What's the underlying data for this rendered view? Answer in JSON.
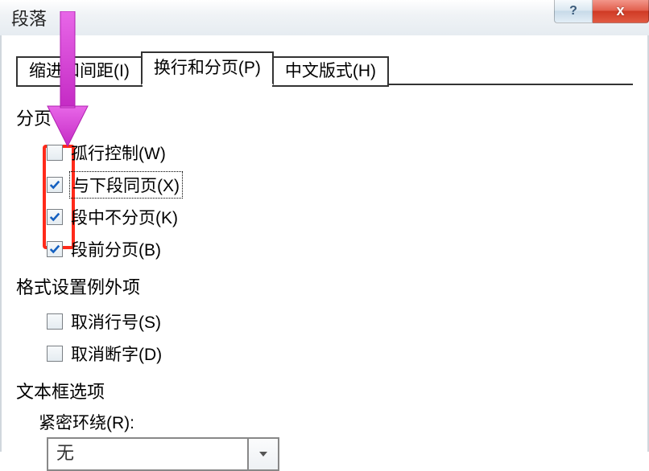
{
  "window": {
    "title": "段落",
    "help_tooltip": "?",
    "close_tooltip": "x"
  },
  "tabs": [
    {
      "label": "缩进和间距(I)",
      "active": false
    },
    {
      "label": "换行和分页(P)",
      "active": true
    },
    {
      "label": "中文版式(H)",
      "active": false
    }
  ],
  "groups": {
    "pagination": {
      "label": "分页",
      "options": [
        {
          "key": "widow",
          "label": "孤行控制(W)",
          "checked": false,
          "focused": false
        },
        {
          "key": "keep_next",
          "label": "与下段同页(X)",
          "checked": true,
          "focused": true
        },
        {
          "key": "keep_lines",
          "label": "段中不分页(K)",
          "checked": true,
          "focused": false
        },
        {
          "key": "page_break",
          "label": "段前分页(B)",
          "checked": true,
          "focused": false
        }
      ]
    },
    "formatting_exceptions": {
      "label": "格式设置例外项",
      "options": [
        {
          "key": "suppress_ln",
          "label": "取消行号(S)",
          "checked": false
        },
        {
          "key": "no_hyphen",
          "label": "取消断字(D)",
          "checked": false
        }
      ]
    },
    "textbox": {
      "label": "文本框选项",
      "tight_wrap_label": "紧密环绕(R):",
      "tight_wrap_value": "无"
    }
  },
  "annotation": {
    "arrow_color": "#d63bd6",
    "highlight_color": "#ff2a1a"
  }
}
